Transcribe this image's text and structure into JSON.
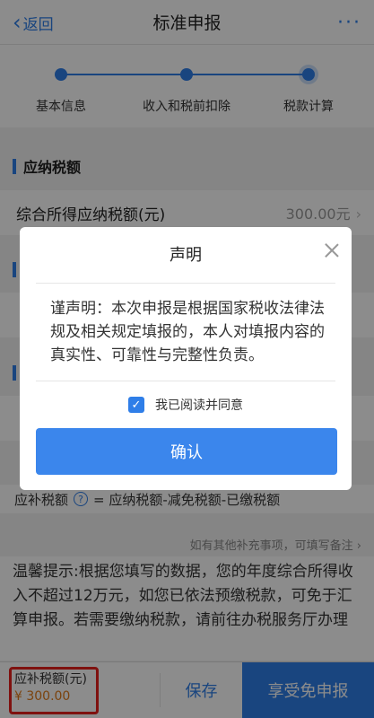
{
  "header": {
    "back_label": "返回",
    "title": "标准申报",
    "more_label": "···"
  },
  "steps": [
    {
      "label": "基本信息"
    },
    {
      "label": "收入和税前扣除"
    },
    {
      "label": "税款计算"
    }
  ],
  "sections": {
    "taxable": {
      "title": "应纳税额",
      "row_label": "综合所得应纳税额(元)",
      "row_value": "300.00元"
    }
  },
  "formula": {
    "prefix": "应补税额",
    "help_icon": "?",
    "text": "= 应纳税额-减免税额-已缴税额"
  },
  "supplement_link": "如有其他补充事项，可填写备注",
  "tip": "温馨提示:根据您填写的数据，您的年度综合所得收入不超过12万元，如您已依法预缴税款，可免于汇算申报。若需要缴纳税款，请前往办税服务厅办理",
  "bottom": {
    "tax_label": "应补税额(元)",
    "tax_amount": "¥ 300.00",
    "save_label": "保存",
    "enjoy_label": "享受免申报"
  },
  "dialog": {
    "title": "声明",
    "text": "谨声明：本次申报是根据国家税收法律法规及相关规定填报的，本人对填报内容的真实性、可靠性与完整性负责。",
    "agree_label": "我已阅读并同意",
    "confirm_label": "确认"
  },
  "colors": {
    "accent": "#2f7ee8",
    "amount": "#e07a1a",
    "highlight": "#e8201c"
  }
}
